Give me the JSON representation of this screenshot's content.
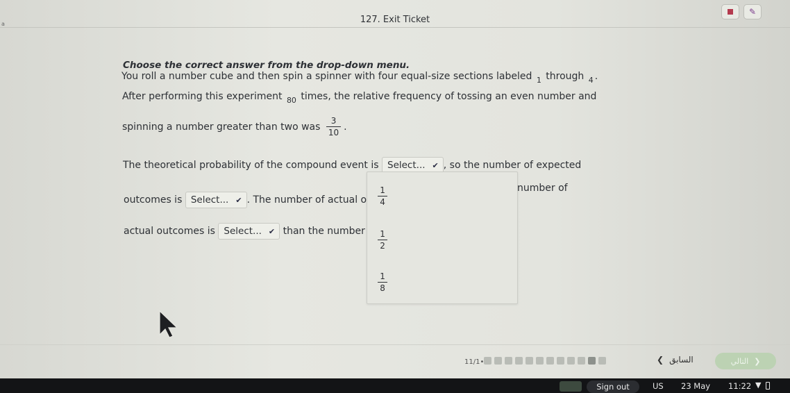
{
  "header": {
    "title": "127. Exit Ticket",
    "corner_mark": "a"
  },
  "question": {
    "instruction": "Choose the correct answer from the drop-down menu.",
    "line1_a": "You roll a number cube and then spin a spinner with four equal-size sections labeled",
    "line1_sub1": "1",
    "line1_b": "through",
    "line1_sub2": "4",
    "line1_end": ".",
    "line2_a": "After performing this experiment",
    "line2_sub": "80",
    "line2_b": "times, the relative frequency of tossing an even number and",
    "line3_a": "spinning a number greater than two was",
    "rel_freq_num": "3",
    "rel_freq_den": "10",
    "line3_end": ".",
    "line4_a": "The theoretical probability of the compound event is",
    "line4_b": ", so the number of expected",
    "line5_a": "outcomes is",
    "line5_b": ". The number of actual out",
    "line5_c": "number of",
    "line6_a": "actual outcomes is",
    "line6_b": "than the number o"
  },
  "selects": {
    "placeholder": "Select..."
  },
  "dropdown": {
    "options": [
      {
        "num": "1",
        "den": "4"
      },
      {
        "num": "1",
        "den": "2"
      },
      {
        "num": "1",
        "den": "8"
      }
    ]
  },
  "footer": {
    "counter": "11/1•",
    "prev_label": "السابق",
    "next_label": "التالي",
    "progress_total": 12,
    "progress_current": 11
  },
  "shelf": {
    "sign_out": "Sign out",
    "ime": "US",
    "date": "23 May",
    "time": "11:22"
  },
  "colors": {
    "stop": "#b43a4e",
    "next_button": "#bcd2b3",
    "shelf": "#131416"
  }
}
